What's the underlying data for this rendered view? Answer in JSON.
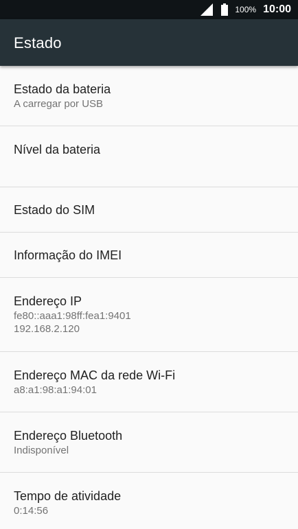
{
  "status_bar": {
    "battery_percent": "100%",
    "time": "10:00",
    "icons": [
      "signal-icon",
      "battery-icon"
    ]
  },
  "app_bar": {
    "title": "Estado"
  },
  "items": [
    {
      "title": "Estado da bateria",
      "subtitle": "A carregar por USB"
    },
    {
      "title": "Nível da bateria",
      "subtitle": ""
    },
    {
      "title": "Estado do SIM"
    },
    {
      "title": "Informação do IMEI"
    },
    {
      "title": "Endereço IP",
      "subtitle": "fe80::aaa1:98ff:fea1:9401",
      "subtitle2": "192.168.2.120"
    },
    {
      "title": "Endereço MAC da rede Wi-Fi",
      "subtitle": "a8:a1:98:a1:94:01"
    },
    {
      "title": "Endereço Bluetooth",
      "subtitle": "Indisponível"
    },
    {
      "title": "Tempo de atividade",
      "subtitle": "0:14:56"
    }
  ],
  "colors": {
    "status_bar_bg": "#0f1417",
    "app_bar_bg": "#263238",
    "page_bg": "#fafafa",
    "title_text": "#212121",
    "subtitle_text": "#737373",
    "divider": "#dcdcdc"
  }
}
